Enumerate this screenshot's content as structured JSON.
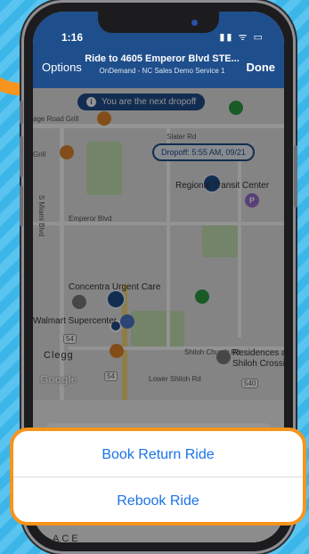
{
  "status_bar": {
    "time": "1:16",
    "icons": "▮▮ ᯤ ▭"
  },
  "nav": {
    "left_button": "Options",
    "title": "Ride to 4605 Emperor Blvd STE...",
    "subtitle": "OnDemand - NC Sales Demo Service 1",
    "right_button": "Done"
  },
  "map": {
    "banner": "You are the next dropoff",
    "banner_icon": "i",
    "dropoff_label": "Dropoff: 5:55 AM, 09/21",
    "labels": {
      "road_grill": "age Road Grill",
      "grill": "Grill",
      "regional": "Regional Transit Center",
      "miami": "S Miami Blvd",
      "emperor": "Emperor Blvd",
      "concentra": "Concentra Urgent Care",
      "walmart": "Walmart Supercenter",
      "clegg": "Clegg",
      "residences1": "Residences at",
      "residences2": "Shiloh Crossing",
      "shiloh_rd": "Shiloh Church Rd",
      "lower_shiloh": "Lower Shiloh Rd",
      "r54": "54",
      "r540": "540",
      "sladeroad": "Slater Rd"
    },
    "google": "Google",
    "parking": "P"
  },
  "sheet": {
    "book_return": "Book Return Ride",
    "rebook": "Rebook Ride"
  },
  "bottom_text": "ACE",
  "colors": {
    "accent": "#1f4e8c",
    "orange": "#f7941d",
    "link": "#1a73e8"
  }
}
